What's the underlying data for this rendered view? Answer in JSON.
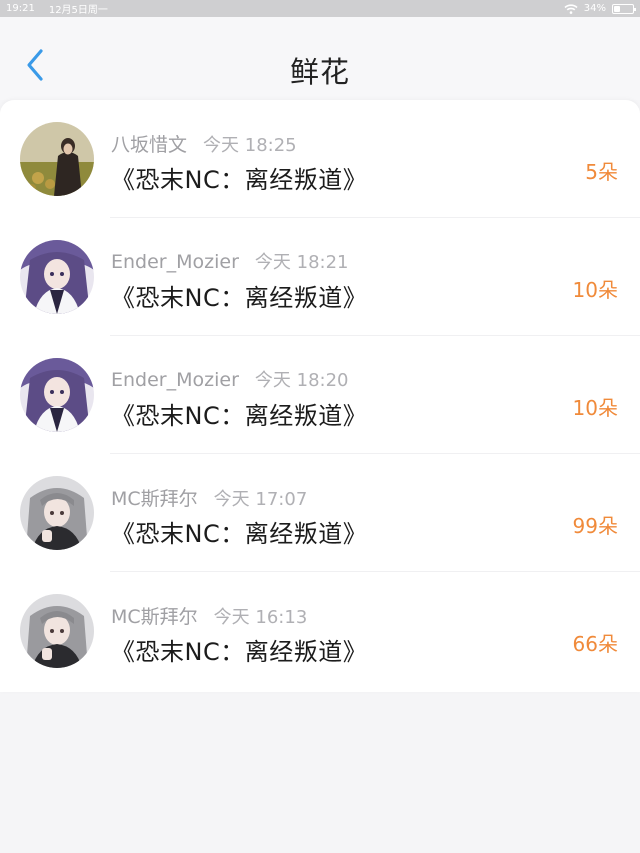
{
  "status_bar": {
    "time": "19:21",
    "date": "12月5日周一",
    "battery": "34%",
    "battery_level": 0.34
  },
  "nav": {
    "back_icon": "chevron-left-icon",
    "title": "鲜花",
    "accent_color": "#3a9ae8"
  },
  "flowers": {
    "count_color": "#f08a3a",
    "items": [
      {
        "user": "八坂惜文",
        "time": "今天 18:25",
        "book": "《恐末NC：离经叛道》",
        "count": "5朵",
        "avatar": "photo-avatar"
      },
      {
        "user": "Ender_Mozier",
        "time": "今天 18:21",
        "book": "《恐末NC：离经叛道》",
        "count": "10朵",
        "avatar": "anime-avatar-purple"
      },
      {
        "user": "Ender_Mozier",
        "time": "今天 18:20",
        "book": "《恐末NC：离经叛道》",
        "count": "10朵",
        "avatar": "anime-avatar-purple"
      },
      {
        "user": "MC斯拜尔",
        "time": "今天 17:07",
        "book": "《恐末NC：离经叛道》",
        "count": "99朵",
        "avatar": "anime-avatar-grey"
      },
      {
        "user": "MC斯拜尔",
        "time": "今天 16:13",
        "book": "《恐末NC：离经叛道》",
        "count": "66朵",
        "avatar": "anime-avatar-grey"
      }
    ]
  }
}
